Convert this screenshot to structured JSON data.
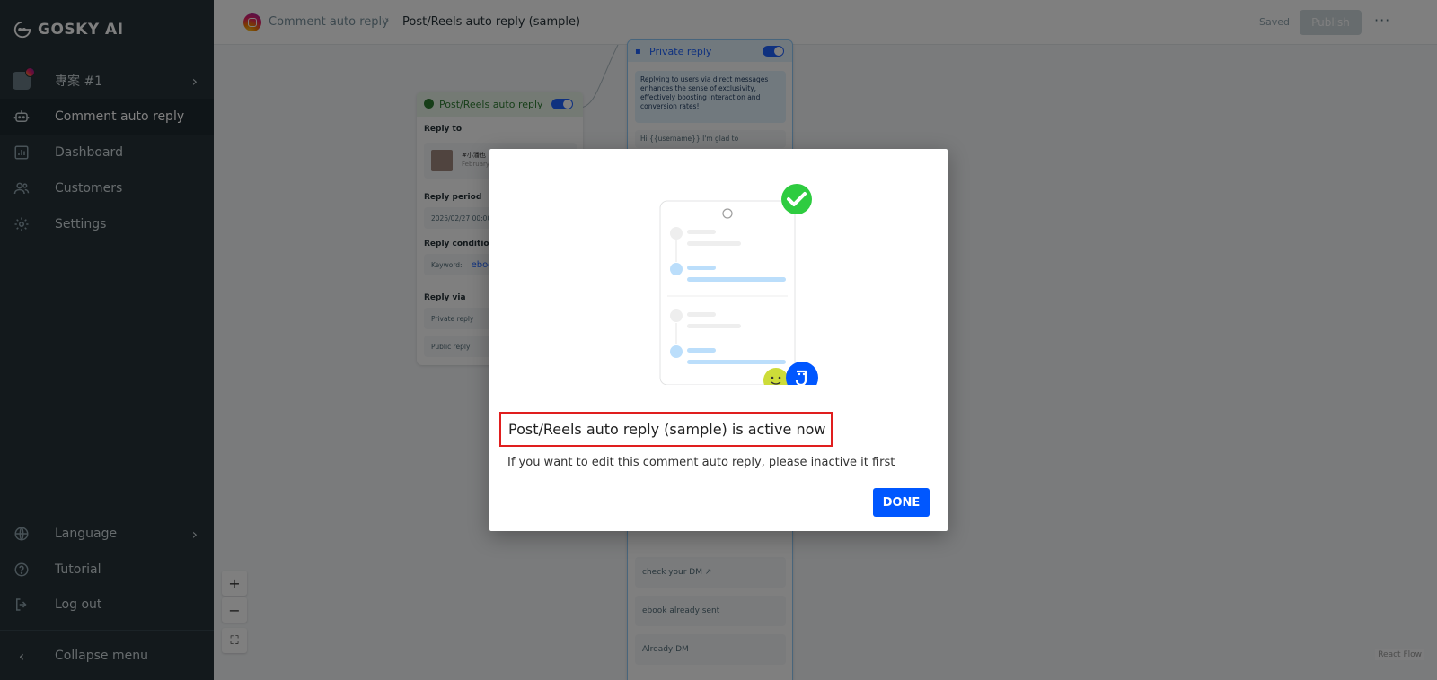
{
  "sidebar": {
    "brand": "GOSKY AI",
    "project": "專案 #1",
    "items": [
      {
        "label": "Comment auto reply",
        "icon": "robot-icon"
      },
      {
        "label": "Dashboard",
        "icon": "chart-icon"
      },
      {
        "label": "Customers",
        "icon": "users-icon"
      },
      {
        "label": "Settings",
        "icon": "gear-icon"
      }
    ],
    "bottom": [
      {
        "label": "Language",
        "icon": "globe-icon"
      },
      {
        "label": "Tutorial",
        "icon": "help-icon"
      },
      {
        "label": "Log out",
        "icon": "logout-icon"
      }
    ],
    "collapse": "Collapse menu"
  },
  "topbar": {
    "breadcrumb_root": "Comment auto reply",
    "breadcrumb_current": "Post/Reels auto reply (sample)",
    "saved": "Saved",
    "publish": "Publish",
    "more": "···"
  },
  "flow": {
    "trigger": {
      "title": "Post/Reels auto reply",
      "reply_to_label": "Reply to",
      "post_caption": "#小潘也",
      "post_date": "February",
      "reply_period_label": "Reply period",
      "reply_period_value": "2025/02/27 00:00",
      "conditions_label": "Reply conditions",
      "keyword_label": "Keyword:",
      "keyword_value": "eboo",
      "reply_via_label": "Reply via",
      "via_private": "Private reply",
      "via_public": "Public reply"
    },
    "private": {
      "title": "Private reply",
      "tip": "Replying to users via direct messages enhances the sense of exclusivity, effectively boosting interaction and conversion rates!",
      "partial_text": "Hi {{username}} I'm glad to",
      "replies": [
        "check your DM ↗",
        "ebook already sent",
        "Already DM"
      ]
    },
    "attribution": "React Flow",
    "zoom_in": "+",
    "zoom_out": "−",
    "fit": "⛶"
  },
  "modal": {
    "title": "Post/Reels auto reply (sample) is active now",
    "description": "If you want to edit this comment auto reply, please inactive it first",
    "done": "DONE"
  },
  "colors": {
    "sidebar_bg": "#263238",
    "primary": "#0057ff",
    "highlight_border": "#e01e1e"
  }
}
